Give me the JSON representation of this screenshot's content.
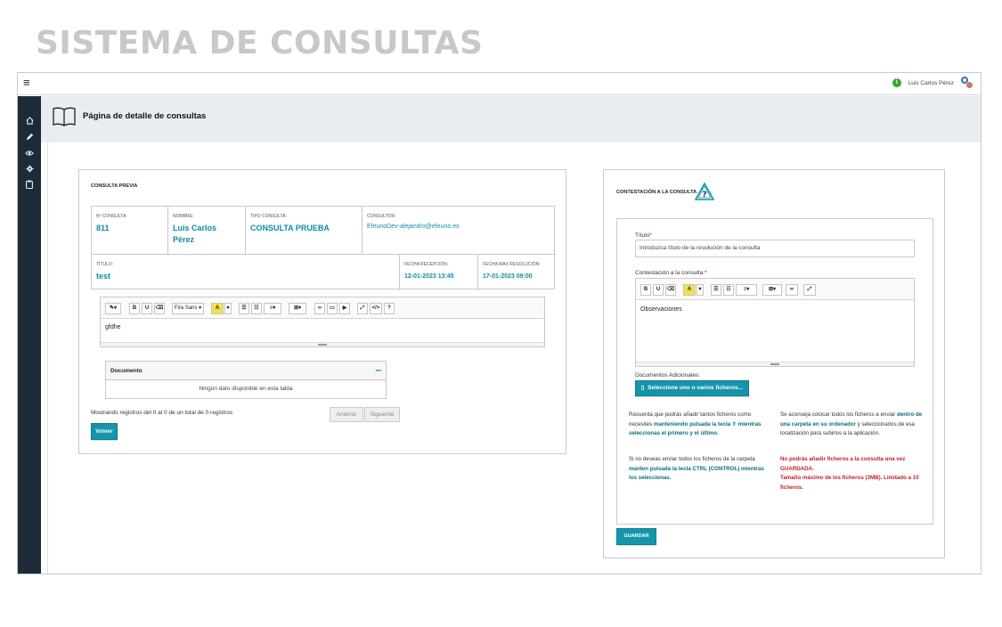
{
  "page_heading": "SISTEMA DE CONSULTAS",
  "topbar": {
    "menu_icon": "hamburger-menu-icon",
    "status_glyph": "i",
    "user_name": "Luis Carlos Pérez"
  },
  "sidebar": {
    "icons": [
      "home-icon",
      "pencil-icon",
      "eye-icon",
      "gear-icon",
      "clipboard-icon"
    ]
  },
  "header": {
    "title": "Página de detalle de consultas"
  },
  "previa": {
    "section_title": "CONSULTA PREVIA",
    "fields": {
      "num_label": "Nº CONSULTA:",
      "num_value": "811",
      "nombre_label": "NOMBRE:",
      "nombre_value": "Luis Carlos Pérez",
      "tipo_label": "TIPO CONSULTA:",
      "tipo_value": "CONSULTA PRUEBA",
      "consultor_label": "CONSULTOR:",
      "consultor_value": "EfeunoDev-alejandro@efeuno.es",
      "titulo_label": "TÍTULO:",
      "titulo_value": "test",
      "recepcion_label": "FECHA RECEPCIÓN:",
      "recepcion_value": "12-01-2023 13:45",
      "max_label": "FECHA MAX RESOLUCIÓN:",
      "max_value": "17-01-2023 09:00"
    },
    "editor": {
      "font_name": "Fira Sans",
      "body_text": "gfdhe"
    },
    "documents": {
      "header": "Documento",
      "empty_text": "Ningún dato disponible en esta tabla",
      "paging_info": "Mostrando registros del 0 al 0 de un total de 0 registros",
      "prev_label": "Anterior",
      "next_label": "Siguiente"
    },
    "back_button": "Volver"
  },
  "contestacion": {
    "section_title": "CONTESTACIÓN A LA CONSULTA",
    "titulo_label": "Título",
    "required_mark": "*",
    "titulo_value": "Introduzca título de la resolución de la consulta",
    "respuesta_label": "Contestación a la consulta:",
    "editor_placeholder": "Observaciones",
    "docs_label": "Documentos Adicionales:",
    "select_files_label": "Seleccione uno o varios ficheros...",
    "notes": {
      "n1_a": "Recuerda que podrás añadir tantos ficheros como necesites ",
      "n1_b": "manteniendo pulsada la tecla ⇧ mientras seleccionas el primero y el último.",
      "n2_a": "Se aconseja colocar todos los ficheros a enviar ",
      "n2_b": "dentro de una carpeta en su ordenador",
      "n2_c": " y seleccionarlos de esa localización para subirlos a la aplicación.",
      "n3_a": "Si no deseas enviar todos los ficheros de la carpeta ",
      "n3_b": "manten pulsada la tecla CTRL (CONTROL) mientras los seleccionas.",
      "n4_a": "No podrás añadir ficheros a la consulta una vez GUARDADA.",
      "n4_b": "Tamaño máximo de los ficheros (3MB). Limitado a 10 ficheros."
    },
    "save_button": "GUARDAR"
  },
  "colors": {
    "accent": "#1595ab",
    "sidebar": "#1d2b38",
    "danger": "#c0202a"
  }
}
